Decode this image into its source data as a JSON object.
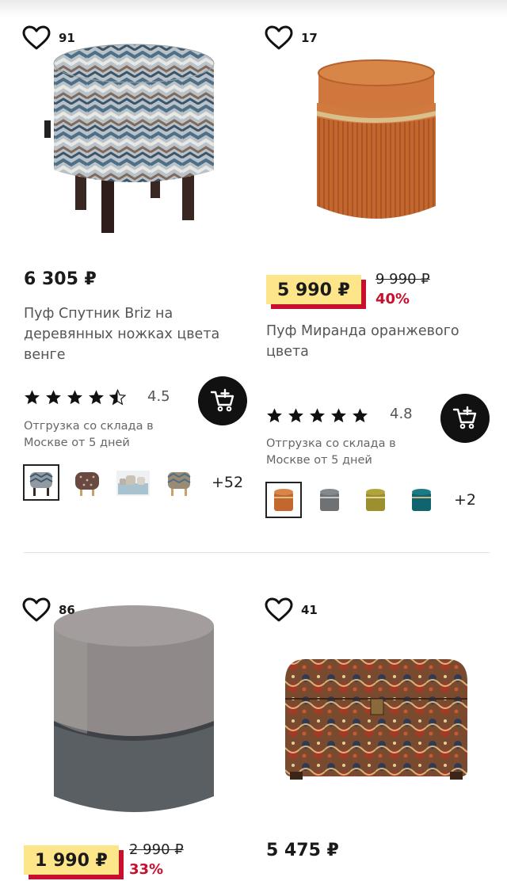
{
  "products": [
    {
      "likes": "91",
      "price": "6 305 ₽",
      "title": "Пуф Спутник Briz на деревянных ножках цвета венге",
      "rating": "4.5",
      "stars": 4.5,
      "shipping": "Отгрузка со склада в Москве от 5 дней",
      "more_variants": "+52"
    },
    {
      "likes": "17",
      "price": "5 990 ₽",
      "old_price": "9 990 ₽",
      "discount": "40%",
      "title": "Пуф Миранда оранжевого цвета",
      "rating": "4.8",
      "stars": 5,
      "shipping": "Отгрузка со склада в Москве от 5 дней",
      "more_variants": "+2"
    },
    {
      "likes": "86",
      "price": "1 990 ₽",
      "old_price": "2 990 ₽",
      "discount": "33%"
    },
    {
      "likes": "41",
      "price": "5 475 ₽"
    }
  ],
  "colors": {
    "badge_bg": "#fde58a",
    "discount_red": "#c8102e",
    "cart_button": "#111111"
  },
  "icons": [
    "heart-icon",
    "star-icon",
    "add-to-cart-icon"
  ]
}
